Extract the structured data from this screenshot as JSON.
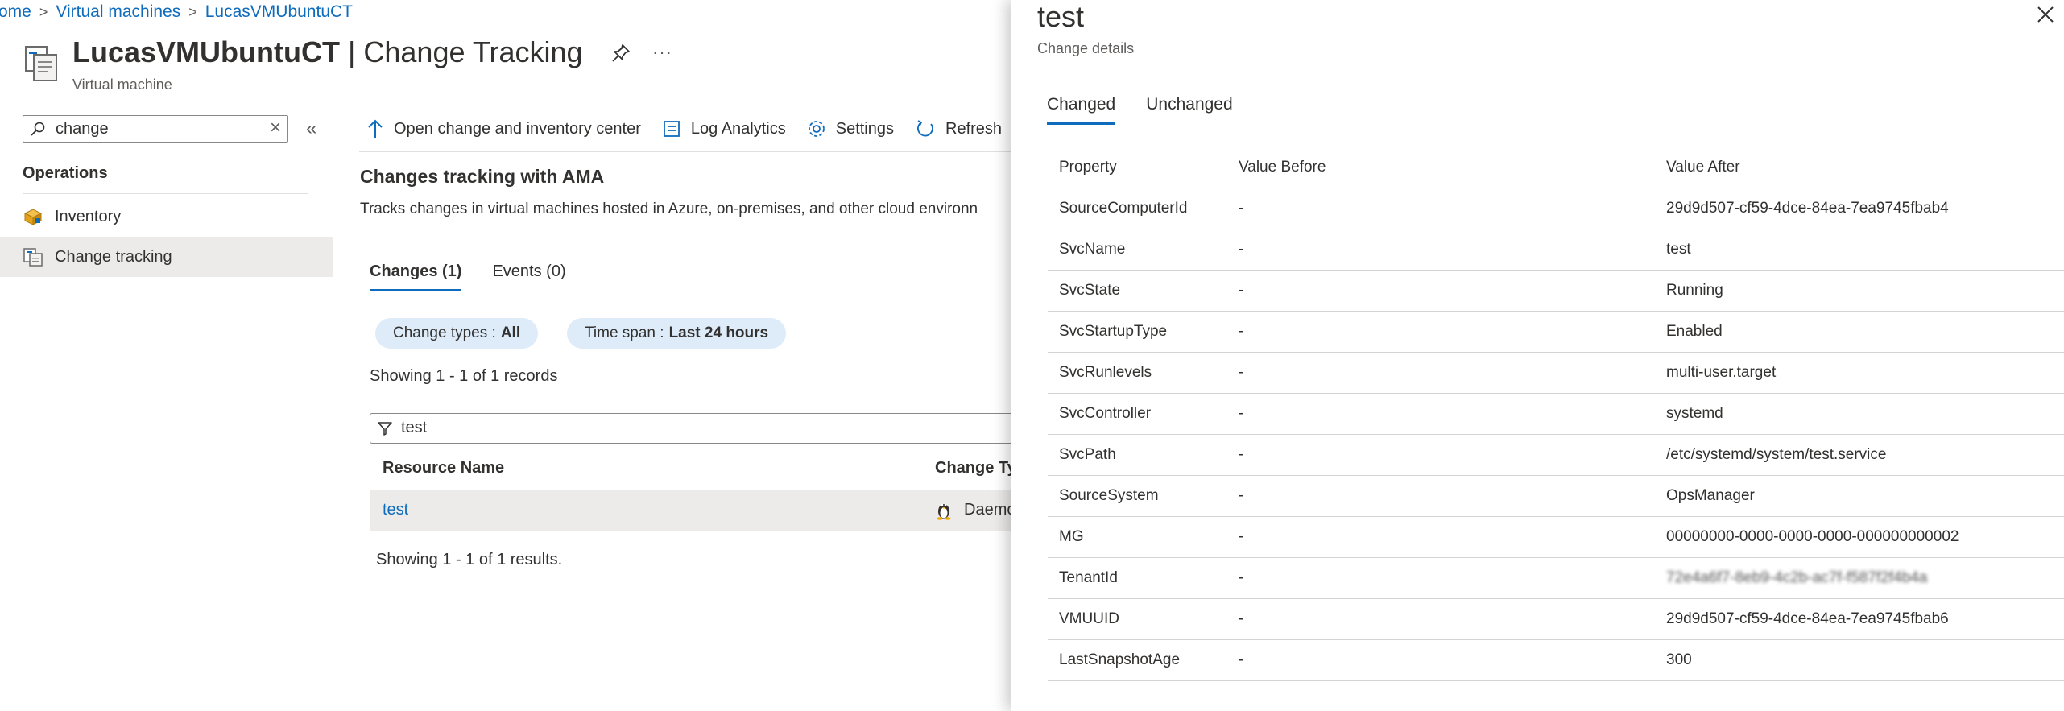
{
  "breadcrumb": {
    "items": [
      "ome",
      "Virtual machines",
      "LucasVMUbuntuCT"
    ]
  },
  "header": {
    "resource_name": "LucasVMUbuntuCT",
    "separator": "|",
    "page_name": "Change Tracking",
    "resource_type": "Virtual machine",
    "more": "···"
  },
  "sidebar": {
    "search": {
      "value": "change",
      "clear": "×"
    },
    "collapse": "«",
    "section_label": "Operations",
    "items": [
      {
        "label": "Inventory",
        "icon": "inventory-icon"
      },
      {
        "label": "Change tracking",
        "icon": "change-tracking-icon",
        "selected": true
      }
    ]
  },
  "toolbar": {
    "open_center": "Open change and inventory center",
    "log_analytics": "Log Analytics",
    "settings": "Settings",
    "refresh": "Refresh"
  },
  "main": {
    "section_title": "Changes tracking with AMA",
    "section_desc": "Tracks changes in virtual machines hosted in Azure, on-premises, and other cloud environn",
    "tabs": [
      "Changes (1)",
      "Events (0)"
    ],
    "filters": {
      "change_types_label": "Change types :",
      "change_types_value": "All",
      "time_span_label": "Time span :",
      "time_span_value": "Last 24 hours"
    },
    "showing_records": "Showing 1 - 1 of 1 records",
    "filter_input": "test",
    "grid": {
      "col_resource": "Resource Name",
      "col_change_type": "Change Ty",
      "row_name": "test",
      "row_type": "Daemo"
    },
    "showing_results": "Showing 1 - 1 of 1 results."
  },
  "panel": {
    "title": "test",
    "subtitle": "Change details",
    "tabs": [
      "Changed",
      "Unchanged"
    ],
    "columns": [
      "Property",
      "Value Before",
      "Value After"
    ],
    "rows": [
      {
        "property": "SourceComputerId",
        "before": "-",
        "after": "29d9d507-cf59-4dce-84ea-7ea9745fbab4"
      },
      {
        "property": "SvcName",
        "before": "-",
        "after": "test"
      },
      {
        "property": "SvcState",
        "before": "-",
        "after": "Running"
      },
      {
        "property": "SvcStartupType",
        "before": "-",
        "after": "Enabled"
      },
      {
        "property": "SvcRunlevels",
        "before": "-",
        "after": "multi-user.target"
      },
      {
        "property": "SvcController",
        "before": "-",
        "after": "systemd"
      },
      {
        "property": "SvcPath",
        "before": "-",
        "after": "/etc/systemd/system/test.service"
      },
      {
        "property": "SourceSystem",
        "before": "-",
        "after": "OpsManager"
      },
      {
        "property": "MG",
        "before": "-",
        "after": "00000000-0000-0000-0000-000000000002"
      },
      {
        "property": "TenantId",
        "before": "-",
        "after": "72e4a6f7-8eb9-4c2b-ac7f-f587f2f4b4a",
        "redacted": true
      },
      {
        "property": "VMUUID",
        "before": "-",
        "after": "29d9d507-cf59-4dce-84ea-7ea9745fbab6"
      },
      {
        "property": "LastSnapshotAge",
        "before": "-",
        "after": "300"
      }
    ]
  },
  "colors": {
    "accent": "#0f6cbd",
    "selected_bg": "#edebe9",
    "pill_bg": "#deecf9"
  }
}
